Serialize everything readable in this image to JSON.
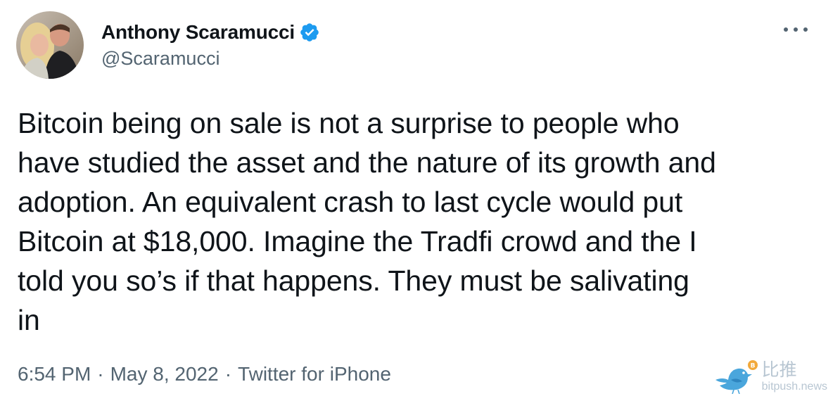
{
  "author": {
    "display_name": "Anthony Scaramucci",
    "handle": "@Scaramucci",
    "verified": true
  },
  "tweet": {
    "text": "Bitcoin being on sale is not a surprise to people who\nhave studied the asset and the nature of its growth and\nadoption. An equivalent crash to last cycle would put\nBitcoin at $18,000. Imagine the Tradfi crowd and the I\ntold you so’s if that happens. They must be salivating\nin"
  },
  "meta": {
    "time": "6:54 PM",
    "separator_1": "·",
    "date": "May 8, 2022",
    "separator_2": "·",
    "source": "Twitter for iPhone"
  },
  "watermark": {
    "chinese": "比推",
    "url": "bitpush.news"
  },
  "colors": {
    "text_primary": "#0f1419",
    "text_secondary": "#536471",
    "verified_blue": "#1d9bf0",
    "watermark": "#b8c6d2"
  },
  "icons": {
    "verified": "verified-badge-icon",
    "more": "more-options-icon",
    "watermark_bird": "bird-logo-icon"
  }
}
